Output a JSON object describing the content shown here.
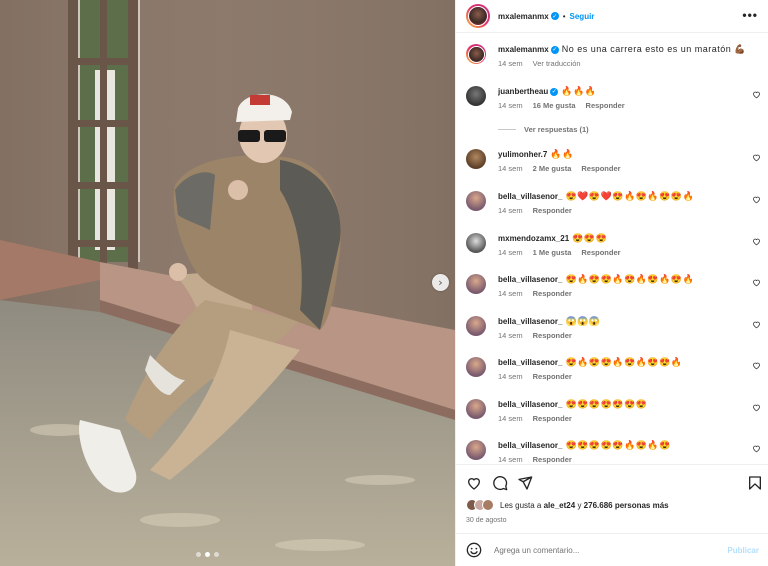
{
  "post": {
    "author": "mxalemanmx",
    "follow_label": "Seguir",
    "separator": "•",
    "more_label": "•••",
    "next_label": "›"
  },
  "caption": {
    "username": "mxalemanmx",
    "text": "No es una carrera esto es un maratón 💪🏾🔥",
    "time": "14 sem",
    "translate_label": "Ver traducción"
  },
  "comments": [
    {
      "username": "juanbertheau",
      "verified": true,
      "text": "🔥🔥🔥",
      "time": "14 sem",
      "likes": "16 Me gusta",
      "reply": "Responder",
      "view_replies": "Ver respuestas (1)"
    },
    {
      "username": "yulimonher.7",
      "verified": false,
      "text": "🔥🔥",
      "time": "14 sem",
      "likes": "2 Me gusta",
      "reply": "Responder"
    },
    {
      "username": "bella_villasenor_",
      "verified": false,
      "text": "😍❤️😍❤️😍🔥😍🔥😍😍🔥",
      "time": "14 sem",
      "likes": "",
      "reply": "Responder"
    },
    {
      "username": "mxmendozamx_21",
      "verified": false,
      "text": "😍😍😍",
      "time": "14 sem",
      "likes": "1 Me gusta",
      "reply": "Responder"
    },
    {
      "username": "bella_villasenor_",
      "verified": false,
      "text": "😍🔥😍😍🔥😍🔥😍🔥😍🔥",
      "time": "14 sem",
      "likes": "",
      "reply": "Responder"
    },
    {
      "username": "bella_villasenor_",
      "verified": false,
      "text": "😱😱😱",
      "time": "14 sem",
      "likes": "",
      "reply": "Responder"
    },
    {
      "username": "bella_villasenor_",
      "verified": false,
      "text": "😍🔥😍😍🔥😍🔥😍😍🔥",
      "time": "14 sem",
      "likes": "",
      "reply": "Responder"
    },
    {
      "username": "bella_villasenor_",
      "verified": false,
      "text": "😍😍😍😍😍😍😍",
      "time": "14 sem",
      "likes": "",
      "reply": "Responder"
    },
    {
      "username": "bella_villasenor_",
      "verified": false,
      "text": "😍😍😍😍😍🔥😍🔥😍",
      "time": "14 sem",
      "likes": "",
      "reply": "Responder"
    }
  ],
  "engagement": {
    "likes_prefix": "Les gusta a",
    "liked_by": "ale_et24",
    "likes_join": "y",
    "likes_count": "276.686 personas más",
    "date": "30 de agosto"
  },
  "composer": {
    "placeholder": "Agrega un comentario...",
    "publish_label": "Publicar"
  },
  "colors": {
    "accent": "#0095f6",
    "publish_disabled": "#b2dffc",
    "secondary_text": "#737373"
  },
  "icons": {
    "like": "heart-icon",
    "comment": "comment-icon",
    "share": "paper-plane-icon",
    "save": "bookmark-icon",
    "emoji": "smiley-icon",
    "verified": "verified-badge-icon"
  },
  "carousel": {
    "current": 2,
    "total": 3
  }
}
